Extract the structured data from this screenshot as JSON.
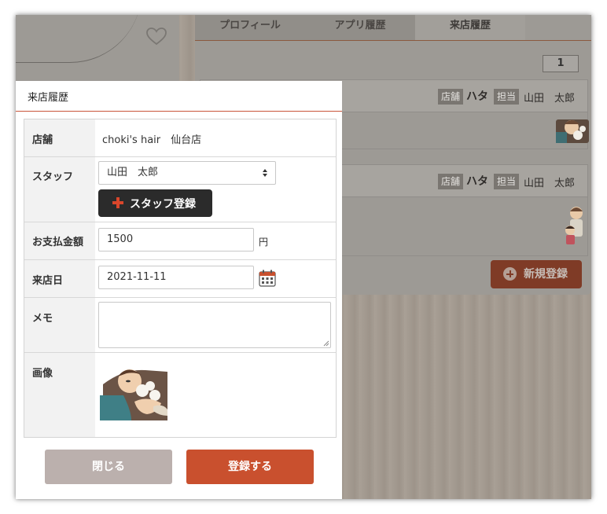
{
  "background": {
    "tabs": [
      {
        "label": "プロフィール",
        "active": false
      },
      {
        "label": "アプリ履歴",
        "active": false
      },
      {
        "label": "来店履歴",
        "active": true
      }
    ],
    "page_number": "1",
    "records": [
      {
        "shop_tag": "店舗",
        "shop": "ハタ",
        "staff_tag": "担当",
        "staff": "山田　太郎"
      },
      {
        "shop_tag": "店舗",
        "shop": "ハタ",
        "staff_tag": "担当",
        "staff": "山田　太郎"
      }
    ],
    "new_button_label": "新規登録"
  },
  "modal": {
    "title": "来店履歴",
    "fields": {
      "shop": {
        "label": "店舗",
        "value": "choki's hair　仙台店"
      },
      "staff": {
        "label": "スタッフ",
        "selected": "山田　太郎",
        "register_button": "スタッフ登録"
      },
      "amount": {
        "label": "お支払金額",
        "value": "1500",
        "unit": "円"
      },
      "date": {
        "label": "来店日",
        "value": "2021-11-11"
      },
      "memo": {
        "label": "メモ",
        "value": ""
      },
      "image": {
        "label": "画像"
      }
    },
    "close_label": "閉じる",
    "submit_label": "登録する"
  },
  "colors": {
    "accent": "#c9502e",
    "dark_button": "#2b2b2b",
    "close_button": "#bbb0ad",
    "label_bg": "#f2f2f2"
  }
}
